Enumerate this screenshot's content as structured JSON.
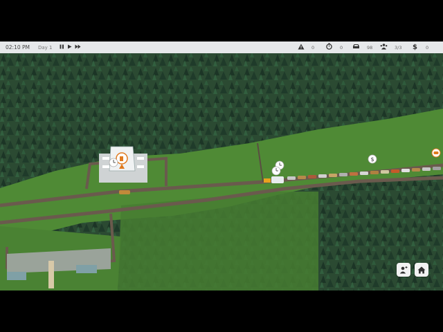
{
  "hud": {
    "time": "02:10 PM",
    "day": "Day 1",
    "controls": {
      "pause_icon": "pause-icon",
      "play_icon": "play-icon",
      "fast_forward_icon": "fast-forward-icon"
    },
    "stats": [
      {
        "name": "warnings",
        "icon": "warning-icon",
        "value": "0"
      },
      {
        "name": "timer",
        "icon": "stopwatch-icon",
        "value": "0"
      },
      {
        "name": "vehicles",
        "icon": "car-icon",
        "value": "98"
      },
      {
        "name": "workers",
        "icon": "people-icon",
        "value": "3/3"
      },
      {
        "name": "money",
        "icon": "dollar-icon",
        "value": "0"
      }
    ]
  },
  "map": {
    "pins": [
      {
        "name": "fuel-pin",
        "icon": "fuel-pump-icon",
        "color": "#e07a1f"
      },
      {
        "name": "clock-pin",
        "icon": "clock-icon"
      },
      {
        "name": "clock-pin-2",
        "icon": "clock-icon"
      },
      {
        "name": "clock-pin-3",
        "icon": "clock-icon"
      },
      {
        "name": "money-pin",
        "icon": "dollar-icon"
      },
      {
        "name": "food-pin",
        "icon": "burger-icon",
        "color": "#e07a1f"
      }
    ]
  },
  "buttons": {
    "add_person_icon": "add-person-icon",
    "home_icon": "home-icon"
  },
  "colors": {
    "grass": "#4f8a35",
    "forest": "#223e2b",
    "road": "#6a5a4d",
    "hud_bg": "#e6e8ea"
  }
}
